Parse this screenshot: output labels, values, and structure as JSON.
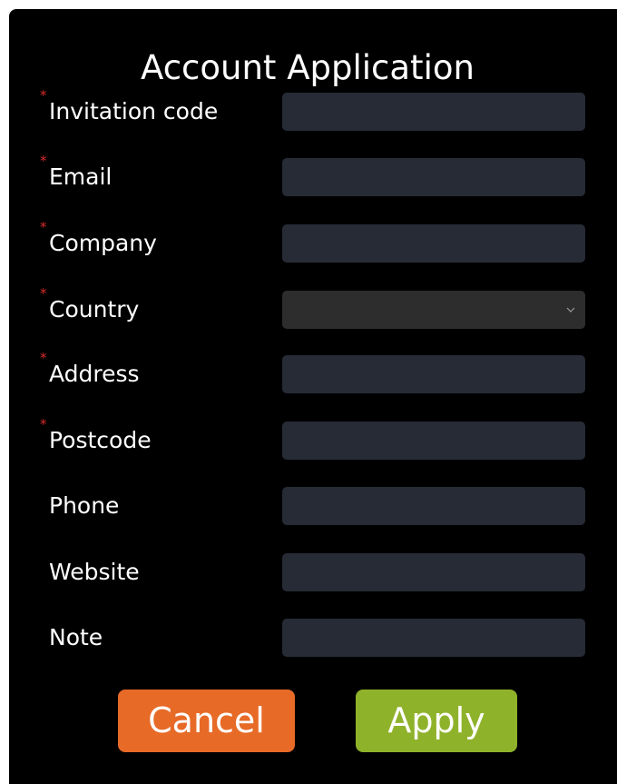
{
  "dialog": {
    "title": "Account Application"
  },
  "form": {
    "fields": [
      {
        "label": "Invitation code",
        "required": true,
        "type": "text",
        "value": ""
      },
      {
        "label": "Email",
        "required": true,
        "type": "text",
        "value": ""
      },
      {
        "label": "Company",
        "required": true,
        "type": "text",
        "value": ""
      },
      {
        "label": "Country",
        "required": true,
        "type": "select",
        "value": ""
      },
      {
        "label": "Address",
        "required": true,
        "type": "text",
        "value": ""
      },
      {
        "label": "Postcode",
        "required": true,
        "type": "text",
        "value": ""
      },
      {
        "label": "Phone",
        "required": false,
        "type": "text",
        "value": ""
      },
      {
        "label": "Website",
        "required": false,
        "type": "text",
        "value": ""
      },
      {
        "label": "Note",
        "required": false,
        "type": "text",
        "value": ""
      }
    ],
    "required_marker": "*"
  },
  "buttons": {
    "cancel_label": "Cancel",
    "apply_label": "Apply"
  },
  "colors": {
    "background": "#000000",
    "field_background": "#262b36",
    "select_background": "#2d2d2d",
    "required_marker": "#d52b2b",
    "cancel_button": "#e76a27",
    "apply_button": "#8fb22b"
  }
}
